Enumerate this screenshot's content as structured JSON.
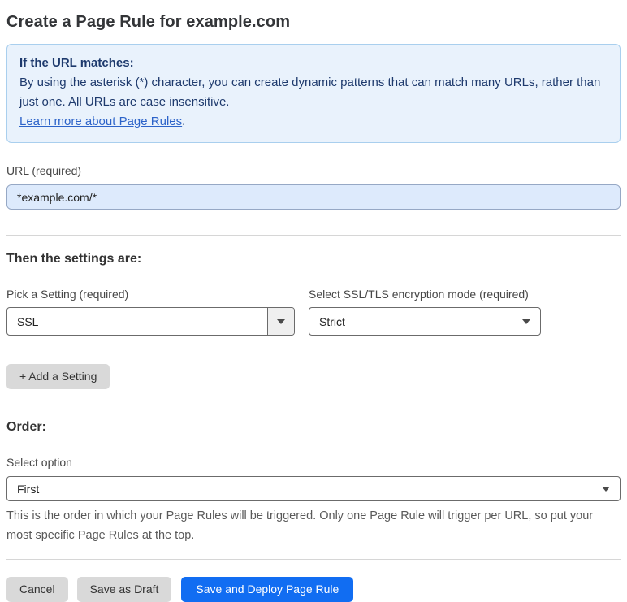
{
  "page": {
    "title": "Create a Page Rule for example.com"
  },
  "info_box": {
    "heading": "If the URL matches:",
    "body": "By using the asterisk (*) character, you can create dynamic patterns that can match many URLs, rather than just one. All URLs are case insensitive.",
    "link_label": "Learn more about Page Rules",
    "link_suffix": "."
  },
  "url_field": {
    "label": "URL (required)",
    "value": "*example.com/*"
  },
  "settings_section": {
    "heading": "Then the settings are:",
    "setting_picker": {
      "label": "Pick a Setting (required)",
      "value": "SSL"
    },
    "ssl_mode_picker": {
      "label": "Select SSL/TLS encryption mode (required)",
      "value": "Strict"
    },
    "add_setting_label": "+ Add a Setting"
  },
  "order_section": {
    "heading": "Order:",
    "select_label": "Select option",
    "value": "First",
    "help_text": "This is the order in which your Page Rules will be triggered. Only one Page Rule will trigger per URL, so put your most specific Page Rules at the top."
  },
  "footer": {
    "cancel_label": "Cancel",
    "save_draft_label": "Save as Draft",
    "save_deploy_label": "Save and Deploy Page Rule"
  },
  "colors": {
    "info_background": "#e9f2fc",
    "info_border": "#a9cfee",
    "info_text": "#1e3a6d",
    "link": "#2c63c9",
    "url_input_background": "#ddeafc",
    "primary_button": "#116df2",
    "gray_button": "#d9d9d9"
  }
}
